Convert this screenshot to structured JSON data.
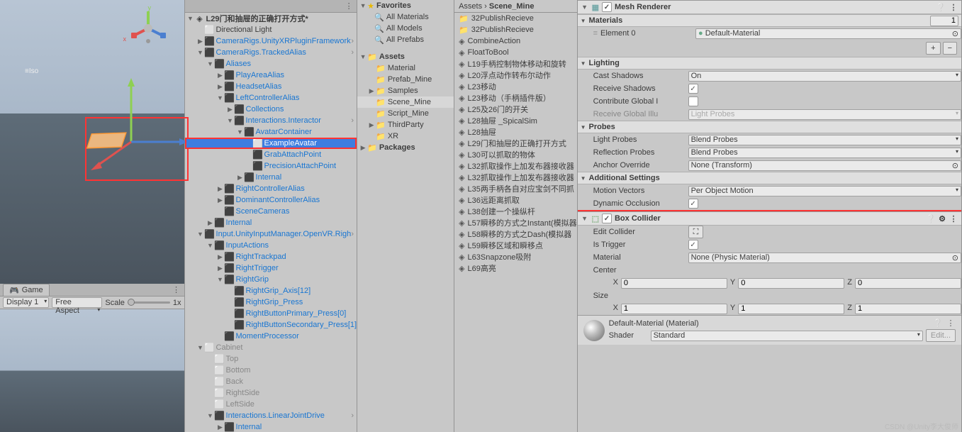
{
  "viewport": {
    "game_tab": "Game",
    "display": "Display 1",
    "aspect": "Free Aspect",
    "scale_label": "Scale",
    "scale_value": "1x",
    "iso_label": "≡Iso",
    "y_label": "y",
    "x_label": "x"
  },
  "hierarchy": {
    "root": "L29门和抽屉的正确打开方式*",
    "items": [
      "Directional Light",
      "CameraRigs.UnityXRPluginFramework",
      "CameraRigs.TrackedAlias",
      "Aliases",
      "PlayAreaAlias",
      "HeadsetAlias",
      "LeftControllerAlias",
      "Collections",
      "Interactions.Interactor",
      "AvatarContainer",
      "ExampleAvatar",
      "GrabAttachPoint",
      "PrecisionAttachPoint",
      "Internal",
      "RightControllerAlias",
      "DominantControllerAlias",
      "SceneCameras",
      "Internal",
      "Input.UnityInputManager.OpenVR.Righ",
      "InputActions",
      "RightTrackpad",
      "RightTrigger",
      "RightGrip",
      "RightGrip_Axis[12]",
      "RightGrip_Press",
      "RightButtonPrimary_Press[0]",
      "RightButtonSecondary_Press[1]",
      "MomentProcessor",
      "Cabinet",
      "Top",
      "Bottom",
      "Back",
      "RightSide",
      "LeftSide",
      "Interactions.LinearJointDrive",
      "Internal"
    ]
  },
  "project": {
    "favorites": "Favorites",
    "fav_items": [
      "All Materials",
      "All Models",
      "All Prefabs"
    ],
    "assets": "Assets",
    "asset_folders": [
      "Material",
      "Prefab_Mine",
      "Samples",
      "Scene_Mine",
      "Script_Mine",
      "ThirdParty",
      "XR"
    ],
    "packages": "Packages",
    "breadcrumb": [
      "Assets",
      "Scene_Mine"
    ],
    "scenes": [
      "32PublishRecieve",
      "32PublishRecieve",
      "CombineAction",
      "FloatToBool",
      "L19手柄控制物体移动和旋转",
      "L20浮点动作转布尔动作",
      "L23移动",
      "L23移动（手柄插件版）",
      "L25及26门的开关",
      "L28抽屉 _SpicalSim",
      "L28抽屉",
      "L29门和抽屉的正确打开方式",
      "L30可以抓取的物体",
      "L32抓取操作上加发布器接收器",
      "L32抓取操作上加发布器接收器",
      "L35两手柄各自对应宝剑不同抓",
      "L36远距离抓取",
      "L38创建一个操纵杆",
      "L57瞬移的方式之Instant(模拟器",
      "L58瞬移的方式之Dash(模拟器",
      "L59瞬移区域和瞬移点",
      "L63Snapzone吸附",
      "L69高亮"
    ]
  },
  "inspector": {
    "mesh_renderer": {
      "title": "Mesh Renderer",
      "materials": "Materials",
      "size": "1",
      "element0_label": "Element 0",
      "element0_value": "Default-Material",
      "plus": "+",
      "minus": "−",
      "lighting": "Lighting",
      "cast_shadows": "Cast Shadows",
      "cast_shadows_val": "On",
      "receive_shadows": "Receive Shadows",
      "contribute_gi": "Contribute Global I",
      "receive_gi": "Receive Global Illu",
      "receive_gi_val": "Light Probes",
      "probes": "Probes",
      "light_probes": "Light Probes",
      "light_probes_val": "Blend Probes",
      "reflection_probes": "Reflection Probes",
      "reflection_probes_val": "Blend Probes",
      "anchor_override": "Anchor Override",
      "anchor_override_val": "None (Transform)",
      "additional": "Additional Settings",
      "motion_vectors": "Motion Vectors",
      "motion_vectors_val": "Per Object Motion",
      "dynamic_occlusion": "Dynamic Occlusion"
    },
    "box_collider": {
      "title": "Box Collider",
      "edit_collider": "Edit Collider",
      "is_trigger": "Is Trigger",
      "material": "Material",
      "material_val": "None (Physic Material)",
      "center": "Center",
      "center_x": "0",
      "center_y": "0",
      "center_z": "0",
      "size": "Size",
      "size_x": "1",
      "size_y": "1",
      "size_z": "1",
      "x": "X",
      "y": "Y",
      "z": "Z"
    },
    "material_shader": {
      "title": "Default-Material (Material)",
      "shader_label": "Shader",
      "shader_val": "Standard",
      "edit": "Edit..."
    }
  },
  "watermark": "CSDN @Unity李大俊师"
}
